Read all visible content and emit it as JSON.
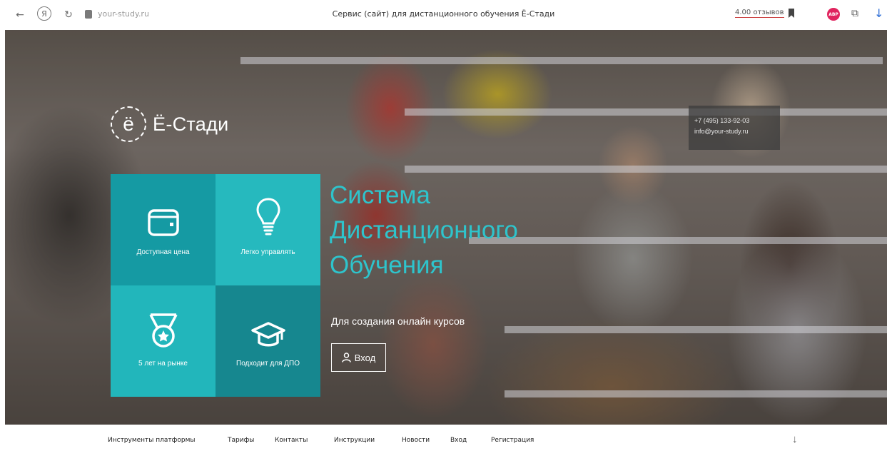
{
  "browser": {
    "url": "your-study.ru",
    "title": "Сервис (сайт) для дистанционного обучения Ё-Стади",
    "reviews": "4.00 отзывов",
    "adblock_label": "ABP"
  },
  "hero": {
    "logo_mark": "ё",
    "logo_text": "Ё-Стади",
    "contact": {
      "phone": "+7 (495) 133-92-03",
      "email": "info@your-study.ru"
    },
    "tiles": [
      {
        "label": "Доступная цена",
        "icon": "wallet-icon"
      },
      {
        "label": "Легко управлять",
        "icon": "lightbulb-icon"
      },
      {
        "label": "5 лет на рынке",
        "icon": "medal-icon"
      },
      {
        "label": "Подходит для ДПО",
        "icon": "graduation-cap-icon"
      }
    ],
    "headline": [
      "Система",
      "Дистанционного",
      "Обучения"
    ],
    "subtitle": "Для создания онлайн курсов",
    "login_label": "Вход"
  },
  "nav": {
    "items": [
      "Инструменты платформы",
      "Тарифы",
      "Контакты",
      "Инструкции",
      "Новости",
      "Вход",
      "Регистрация"
    ]
  },
  "colors": {
    "accent": "#2ec4cc",
    "tile_dark": "#159aa3",
    "tile_light": "#26b9be"
  }
}
